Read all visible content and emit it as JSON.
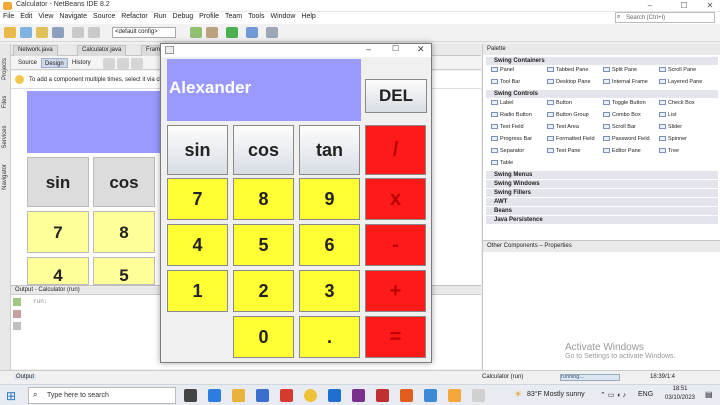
{
  "window": {
    "title": "Calculator - NetBeans IDE 8.2"
  },
  "menu": [
    "File",
    "Edit",
    "View",
    "Navigate",
    "Source",
    "Refactor",
    "Run",
    "Debug",
    "Profile",
    "Team",
    "Tools",
    "Window",
    "Help"
  ],
  "search": {
    "placeholder": "Search (Ctrl+I)"
  },
  "toolbar": {
    "config": "<default config>"
  },
  "side_tabs": [
    "Projects",
    "Files",
    "Services",
    "Navigator"
  ],
  "file_tabs": [
    "Network.java",
    "Calculator.java",
    "Fram"
  ],
  "design_tabs": [
    "Source",
    "Design",
    "History"
  ],
  "hint": "To add a component multiple times, select it via click",
  "background_buttons": [
    "sin",
    "cos",
    "7",
    "8",
    "4",
    "5"
  ],
  "output": {
    "title": "Output - Calculator (run)",
    "tab": "Output",
    "line": "run:"
  },
  "palette": {
    "title": "Palette",
    "sections": [
      "Swing Containers",
      "Swing Controls",
      "Swing Menus",
      "Swing Windows",
      "Swing Fillers",
      "AWT",
      "Beans",
      "Java Persistence"
    ],
    "containers": [
      "Panel",
      "Tabbed Pane",
      "Split Pane",
      "Scroll Pane",
      "Tool Bar",
      "Desktop Pane",
      "Internal Frame",
      "Layered Pane"
    ],
    "controls": [
      "Label",
      "Button",
      "Toggle Button",
      "Check Box",
      "Radio Button",
      "Button Group",
      "Combo Box",
      "List",
      "Text Field",
      "Text Area",
      "Scroll Bar",
      "Slider",
      "Progress Bar",
      "Formatted Field",
      "Password Field",
      "Spinner",
      "Separator",
      "Text Pane",
      "Editor Pane",
      "Tree",
      "Table"
    ]
  },
  "other_props": "Other Components – Properties",
  "activate": {
    "line1": "Activate Windows",
    "line2": "Go to Settings to activate Windows."
  },
  "status": {
    "project": "Calculator (run)",
    "running": "running...",
    "pos": "18:39/1:4"
  },
  "taskbar": {
    "search": "Type here to search",
    "weather": "83°F  Mostly sunny",
    "lang": "ENG",
    "time": "18:51",
    "date": "03/10/2023"
  },
  "calculator": {
    "display": "Alexander",
    "del": "DEL",
    "keys": [
      "sin",
      "cos",
      "tan",
      "/",
      "7",
      "8",
      "9",
      "x",
      "4",
      "5",
      "6",
      "-",
      "1",
      "2",
      "3",
      "+",
      "0",
      ".",
      "="
    ],
    "colors": {
      "display": "#9999ff",
      "digit": "#ffff33",
      "operator": "#ff1a1a"
    }
  }
}
